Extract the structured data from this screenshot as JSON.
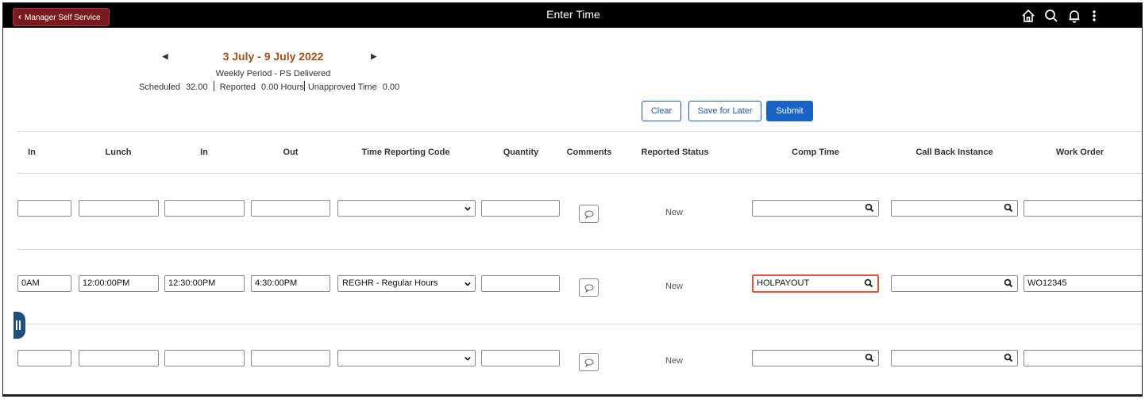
{
  "header": {
    "back_label": "Manager Self Service",
    "title": "Enter Time",
    "icons": [
      "home-icon",
      "search-icon",
      "bell-icon",
      "more-vertical-icon"
    ]
  },
  "period": {
    "title": "3 July - 9 July 2022",
    "subtitle": "Weekly Period - PS Delivered",
    "scheduled_label": "Scheduled",
    "scheduled_value": "32.00",
    "reported_label": "Reported",
    "reported_value": "0.00 Hours",
    "unapproved_label": "Unapproved Time",
    "unapproved_value": "0.00"
  },
  "actions": {
    "clear": "Clear",
    "save_for_later": "Save for Later",
    "submit": "Submit"
  },
  "columns": [
    "In",
    "Lunch",
    "In",
    "Out",
    "Time Reporting Code",
    "Quantity",
    "Comments",
    "Reported Status",
    "Comp Time",
    "Call Back Instance",
    "Work Order"
  ],
  "rows": [
    {
      "in1": "",
      "lunch": "",
      "in2": "",
      "out": "",
      "trc": "",
      "quantity": "",
      "status": "New",
      "comp_time": "",
      "call_back": "",
      "work_order": ""
    },
    {
      "in1": "0AM",
      "lunch": "12:00:00PM",
      "in2": "12:30:00PM",
      "out": "4:30:00PM",
      "trc": "REGHR - Regular Hours",
      "quantity": "",
      "status": "New",
      "comp_time": "HOLPAYOUT",
      "call_back": "",
      "work_order": "WO12345"
    },
    {
      "in1": "",
      "lunch": "",
      "in2": "",
      "out": "",
      "trc": "",
      "quantity": "",
      "status": "New",
      "comp_time": "",
      "call_back": "",
      "work_order": ""
    }
  ],
  "colors": {
    "header_bg": "#000000",
    "back_button_bg": "#7a1a1e",
    "period_title": "#a4511c",
    "primary": "#1a63c7",
    "highlight": "#e4533a",
    "side_tab": "#1f4f7d"
  }
}
